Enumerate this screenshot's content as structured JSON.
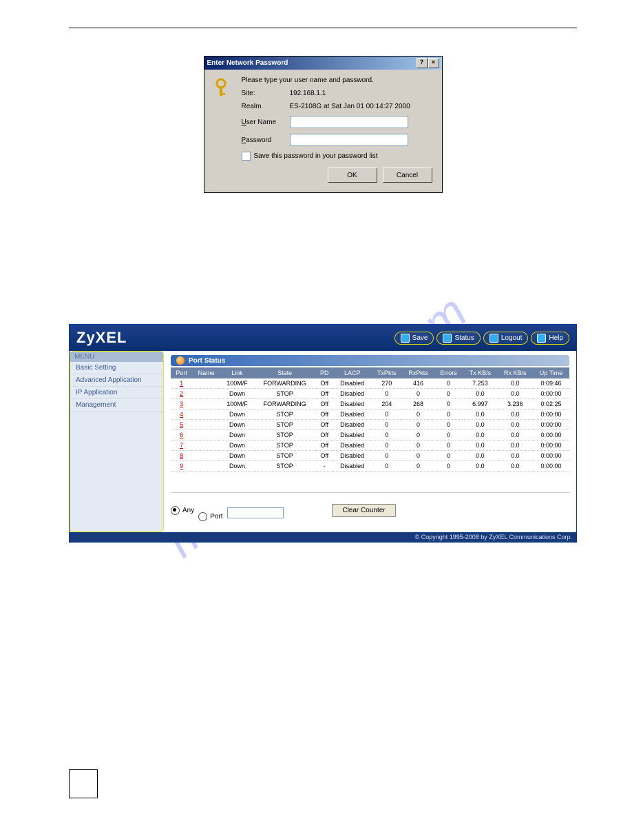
{
  "dialog": {
    "title": "Enter Network Password",
    "instruction": "Please type your user name and password.",
    "site_label": "Site:",
    "site_value": "192.168.1.1",
    "realm_label": "Realm",
    "realm_value": "ES-2108G at Sat Jan 01 00:14:27 2000",
    "username_label": "User Name",
    "password_label": "Password",
    "save_checkbox_label": "Save this password in your password list",
    "ok_label": "OK",
    "cancel_label": "Cancel"
  },
  "header_buttons": {
    "save": "Save",
    "status": "Status",
    "logout": "Logout",
    "help": "Help"
  },
  "logo_text": "ZyXEL",
  "sidebar": {
    "menu_label": "MENU",
    "items": [
      "Basic Setting",
      "Advanced Application",
      "IP Application",
      "Management"
    ]
  },
  "port_status": {
    "title": "Port Status",
    "columns": [
      "Port",
      "Name",
      "Link",
      "State",
      "PD",
      "LACP",
      "TxPkts",
      "RxPkts",
      "Errors",
      "Tx KB/s",
      "Rx KB/s",
      "Up Time"
    ],
    "rows": [
      {
        "port": "1",
        "name": "",
        "link": "100M/F",
        "state": "FORWARDING",
        "pd": "Off",
        "lacp": "Disabled",
        "tx": "270",
        "rx": "416",
        "err": "0",
        "txk": "7.253",
        "rxk": "0.0",
        "up": "0:09:46"
      },
      {
        "port": "2",
        "name": "",
        "link": "Down",
        "state": "STOP",
        "pd": "Off",
        "lacp": "Disabled",
        "tx": "0",
        "rx": "0",
        "err": "0",
        "txk": "0.0",
        "rxk": "0.0",
        "up": "0:00:00"
      },
      {
        "port": "3",
        "name": "",
        "link": "100M/F",
        "state": "FORWARDING",
        "pd": "Off",
        "lacp": "Disabled",
        "tx": "204",
        "rx": "268",
        "err": "0",
        "txk": "6.997",
        "rxk": "3.236",
        "up": "0:02:25"
      },
      {
        "port": "4",
        "name": "",
        "link": "Down",
        "state": "STOP",
        "pd": "Off",
        "lacp": "Disabled",
        "tx": "0",
        "rx": "0",
        "err": "0",
        "txk": "0.0",
        "rxk": "0.0",
        "up": "0:00:00"
      },
      {
        "port": "5",
        "name": "",
        "link": "Down",
        "state": "STOP",
        "pd": "Off",
        "lacp": "Disabled",
        "tx": "0",
        "rx": "0",
        "err": "0",
        "txk": "0.0",
        "rxk": "0.0",
        "up": "0:00:00"
      },
      {
        "port": "6",
        "name": "",
        "link": "Down",
        "state": "STOP",
        "pd": "Off",
        "lacp": "Disabled",
        "tx": "0",
        "rx": "0",
        "err": "0",
        "txk": "0.0",
        "rxk": "0.0",
        "up": "0:00:00"
      },
      {
        "port": "7",
        "name": "",
        "link": "Down",
        "state": "STOP",
        "pd": "Off",
        "lacp": "Disabled",
        "tx": "0",
        "rx": "0",
        "err": "0",
        "txk": "0.0",
        "rxk": "0.0",
        "up": "0:00:00"
      },
      {
        "port": "8",
        "name": "",
        "link": "Down",
        "state": "STOP",
        "pd": "Off",
        "lacp": "Disabled",
        "tx": "0",
        "rx": "0",
        "err": "0",
        "txk": "0.0",
        "rxk": "0.0",
        "up": "0:00:00"
      },
      {
        "port": "9",
        "name": "",
        "link": "Down",
        "state": "STOP",
        "pd": "-",
        "lacp": "Disabled",
        "tx": "0",
        "rx": "0",
        "err": "0",
        "txk": "0.0",
        "rxk": "0.0",
        "up": "0:00:00"
      }
    ],
    "radio_any": "Any",
    "radio_port": "Port",
    "clear_button": "Clear Counter"
  },
  "footer": "© Copyright 1995-2008 by ZyXEL Communications Corp.",
  "watermark": "manualshive.com"
}
